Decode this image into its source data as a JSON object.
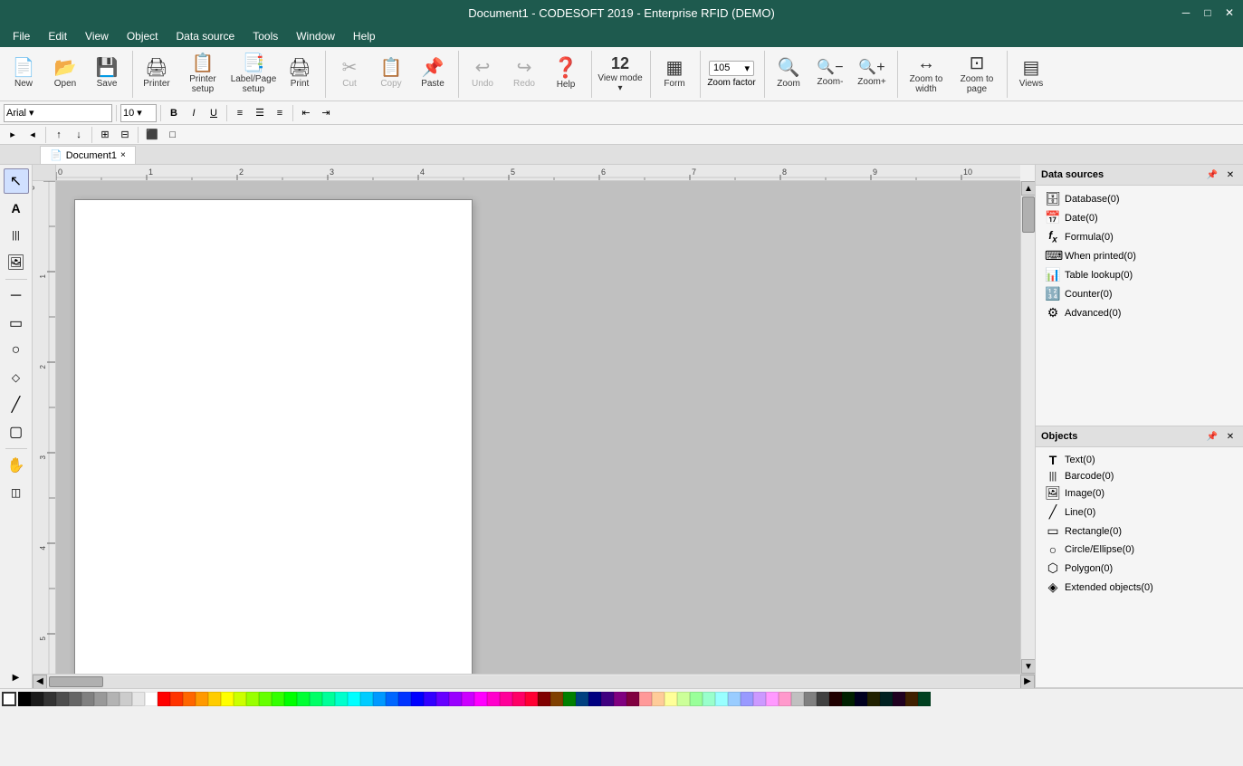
{
  "titleBar": {
    "title": "Document1 - CODESOFT 2019 - Enterprise RFID (DEMO)",
    "minimize": "─",
    "maximize": "□",
    "close": "✕"
  },
  "menu": {
    "items": [
      "File",
      "Edit",
      "View",
      "Object",
      "Data source",
      "Tools",
      "Window",
      "Help"
    ]
  },
  "toolbar": {
    "groups": [
      {
        "buttons": [
          {
            "id": "new",
            "icon": "📄",
            "label": "New"
          },
          {
            "id": "open",
            "icon": "📂",
            "label": "Open"
          },
          {
            "id": "save",
            "icon": "💾",
            "label": "Save"
          }
        ]
      },
      {
        "buttons": [
          {
            "id": "printer",
            "icon": "🖨",
            "label": "Printer"
          },
          {
            "id": "printersetup",
            "icon": "📋",
            "label": "Printer setup"
          },
          {
            "id": "labelsetup",
            "icon": "📑",
            "label": "Label/Page setup"
          },
          {
            "id": "print",
            "icon": "🖨",
            "label": "Print"
          }
        ]
      },
      {
        "buttons": [
          {
            "id": "cut",
            "icon": "✂",
            "label": "Cut",
            "disabled": true
          },
          {
            "id": "copy",
            "icon": "📋",
            "label": "Copy",
            "disabled": true
          },
          {
            "id": "paste",
            "icon": "📌",
            "label": "Paste"
          }
        ]
      },
      {
        "buttons": [
          {
            "id": "undo",
            "icon": "↩",
            "label": "Undo",
            "disabled": true
          },
          {
            "id": "redo",
            "icon": "↪",
            "label": "Redo",
            "disabled": true
          },
          {
            "id": "help",
            "icon": "❓",
            "label": "Help"
          }
        ]
      },
      {
        "buttons": [
          {
            "id": "viewmode",
            "icon": "12",
            "label": "View mode",
            "isViewMode": true
          }
        ]
      },
      {
        "buttons": [
          {
            "id": "form",
            "icon": "▦",
            "label": "Form"
          }
        ]
      },
      {
        "zoomFactor": true,
        "value": "105",
        "label": "Zoom factor"
      },
      {
        "buttons": [
          {
            "id": "zoom",
            "icon": "🔍",
            "label": "Zoom"
          },
          {
            "id": "zoomout",
            "icon": "🔍",
            "label": "Zoom-"
          },
          {
            "id": "zoomin",
            "icon": "🔍",
            "label": "Zoom+"
          }
        ]
      },
      {
        "buttons": [
          {
            "id": "zoomwidth",
            "icon": "↔",
            "label": "Zoom to width"
          },
          {
            "id": "zoompage",
            "icon": "⊡",
            "label": "Zoom to page"
          }
        ]
      },
      {
        "buttons": [
          {
            "id": "views",
            "icon": "▤",
            "label": "Views"
          }
        ]
      }
    ]
  },
  "documentTab": {
    "name": "Document1",
    "closeBtn": "×"
  },
  "toolbox": {
    "tools": [
      {
        "id": "select",
        "icon": "↖",
        "label": "Select"
      },
      {
        "id": "text",
        "icon": "A",
        "label": "Text"
      },
      {
        "id": "barcode",
        "icon": "▋▋▋",
        "label": "Barcode"
      },
      {
        "id": "image",
        "icon": "🖼",
        "label": "Image"
      },
      {
        "id": "sep1"
      },
      {
        "id": "line-h",
        "icon": "─",
        "label": "Horizontal line"
      },
      {
        "id": "rect",
        "icon": "▭",
        "label": "Rectangle"
      },
      {
        "id": "circle",
        "icon": "○",
        "label": "Circle"
      },
      {
        "id": "diamond",
        "icon": "◇",
        "label": "Diamond"
      },
      {
        "id": "line-d",
        "icon": "╱",
        "label": "Diagonal line"
      },
      {
        "id": "roundrect",
        "icon": "▢",
        "label": "Rounded rectangle"
      },
      {
        "id": "sep2"
      },
      {
        "id": "hand",
        "icon": "✋",
        "label": "Pan"
      },
      {
        "id": "rfid",
        "icon": "◫",
        "label": "RFID"
      }
    ]
  },
  "rulers": {
    "hTicks": [
      0,
      1,
      2,
      3,
      4,
      5,
      6,
      7,
      8,
      9,
      10
    ],
    "vTicks": [
      0,
      1,
      2,
      3,
      4,
      5
    ]
  },
  "colorBar": {
    "colors": [
      "#000000",
      "#1a1a1a",
      "#333333",
      "#4d4d4d",
      "#666666",
      "#808080",
      "#999999",
      "#b3b3b3",
      "#cccccc",
      "#e6e6e6",
      "#ffffff",
      "#ff0000",
      "#ff3300",
      "#ff6600",
      "#ff9900",
      "#ffcc00",
      "#ffff00",
      "#ccff00",
      "#99ff00",
      "#66ff00",
      "#33ff00",
      "#00ff00",
      "#00ff33",
      "#00ff66",
      "#00ff99",
      "#00ffcc",
      "#00ffff",
      "#00ccff",
      "#0099ff",
      "#0066ff",
      "#0033ff",
      "#0000ff",
      "#3300ff",
      "#6600ff",
      "#9900ff",
      "#cc00ff",
      "#ff00ff",
      "#ff00cc",
      "#ff0099",
      "#ff0066",
      "#ff0033",
      "#800000",
      "#804000",
      "#008000",
      "#004080",
      "#000080",
      "#400080",
      "#800080",
      "#800040",
      "#ff9999",
      "#ffcc99",
      "#ffff99",
      "#ccff99",
      "#99ff99",
      "#99ffcc",
      "#99ffff",
      "#99ccff",
      "#9999ff",
      "#cc99ff",
      "#ff99ff",
      "#ff99cc",
      "#c0c0c0",
      "#808080",
      "#404040",
      "#200000",
      "#002000",
      "#000020",
      "#202000",
      "#002020",
      "#200020",
      "#402000",
      "#004020"
    ]
  },
  "dataSources": {
    "panelTitle": "Data sources",
    "items": [
      {
        "id": "database",
        "icon": "🗄",
        "label": "Database(0)"
      },
      {
        "id": "date",
        "icon": "📅",
        "label": "Date(0)"
      },
      {
        "id": "formula",
        "icon": "fx",
        "label": "Formula(0)"
      },
      {
        "id": "whenprinted",
        "icon": "⌨",
        "label": "When printed(0)"
      },
      {
        "id": "tablelookup",
        "icon": "📊",
        "label": "Table lookup(0)"
      },
      {
        "id": "counter",
        "icon": "🔢",
        "label": "Counter(0)"
      },
      {
        "id": "advanced",
        "icon": "⚙",
        "label": "Advanced(0)"
      }
    ]
  },
  "objects": {
    "panelTitle": "Objects",
    "items": [
      {
        "id": "text",
        "icon": "T",
        "label": "Text(0)"
      },
      {
        "id": "barcode",
        "icon": "▋▋▋",
        "label": "Barcode(0)"
      },
      {
        "id": "image",
        "icon": "🖼",
        "label": "Image(0)"
      },
      {
        "id": "line",
        "icon": "╱",
        "label": "Line(0)"
      },
      {
        "id": "rectangle",
        "icon": "▭",
        "label": "Rectangle(0)"
      },
      {
        "id": "circleellipse",
        "icon": "○",
        "label": "Circle/Ellipse(0)"
      },
      {
        "id": "polygon",
        "icon": "⬡",
        "label": "Polygon(0)"
      },
      {
        "id": "extended",
        "icon": "◈",
        "label": "Extended objects(0)"
      }
    ]
  }
}
